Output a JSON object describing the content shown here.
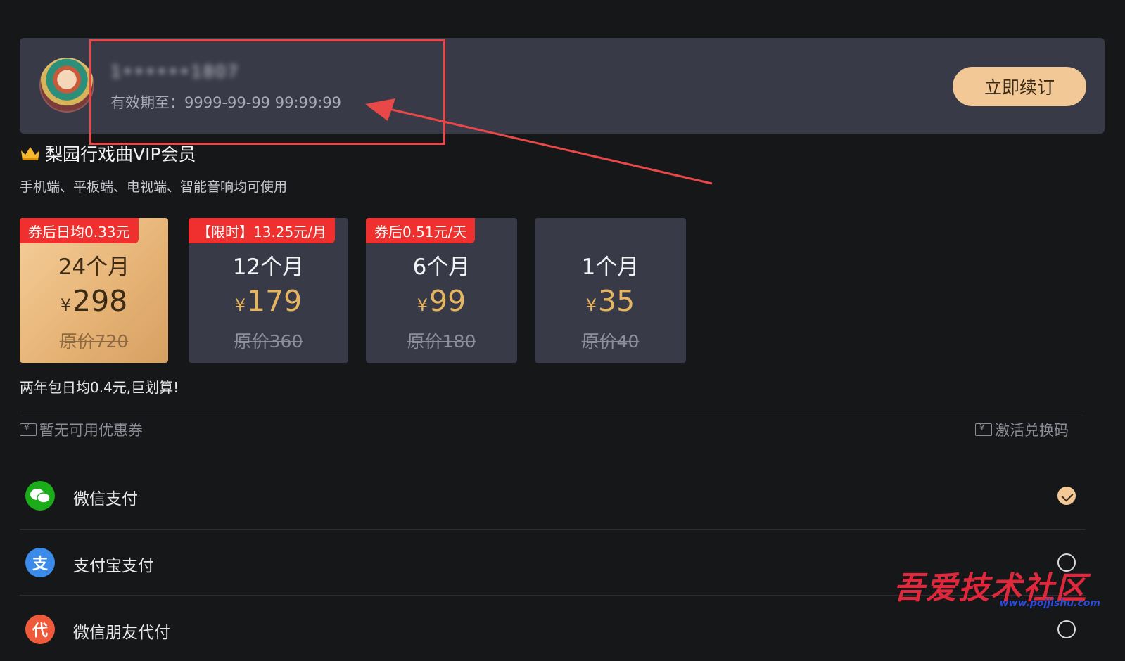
{
  "account": {
    "username": "1••••••1807",
    "expiry": "有效期至：9999-99-99 99:99:99",
    "renew_label": "立即续订"
  },
  "membership": {
    "title": "梨园行戏曲VIP会员",
    "subtitle": "手机端、平板端、电视端、智能音响均可使用"
  },
  "plans": [
    {
      "tag": "券后日均0.33元",
      "duration": "24个月",
      "currency": "¥",
      "price": "298",
      "original": "原价720",
      "selected": true
    },
    {
      "tag": "【限时】13.25元/月",
      "duration": "12个月",
      "currency": "¥",
      "price": "179",
      "original": "原价360",
      "selected": false
    },
    {
      "tag": "券后0.51元/天",
      "duration": "6个月",
      "currency": "¥",
      "price": "99",
      "original": "原价180",
      "selected": false
    },
    {
      "tag": "",
      "duration": "1个月",
      "currency": "¥",
      "price": "35",
      "original": "原价40",
      "selected": false
    }
  ],
  "promo_text": "两年包日均0.4元,巨划算!",
  "coupon": {
    "label": "暂无可用优惠券",
    "icon": "ticket-icon"
  },
  "redeem": {
    "label": "激活兑换码",
    "icon": "code-icon"
  },
  "payment_methods": [
    {
      "label": "微信支付",
      "icon": "wechat-icon",
      "color": "#1aad19",
      "glyph": "●",
      "checked": true
    },
    {
      "label": "支付宝支付",
      "icon": "alipay-icon",
      "color": "#3a8bea",
      "glyph": "支",
      "checked": false
    },
    {
      "label": "微信朋友代付",
      "icon": "friend-pay-icon",
      "color": "#f05a3c",
      "glyph": "代",
      "checked": false
    }
  ],
  "watermark": {
    "main": "吾爱技术社区",
    "url": "www.pojjishu.com"
  },
  "colors": {
    "accent": "#f1c896",
    "tag_red": "#f0302e",
    "price_gold": "#e6b560",
    "card_bg": "#383a48",
    "annotation_red": "#e84848"
  }
}
